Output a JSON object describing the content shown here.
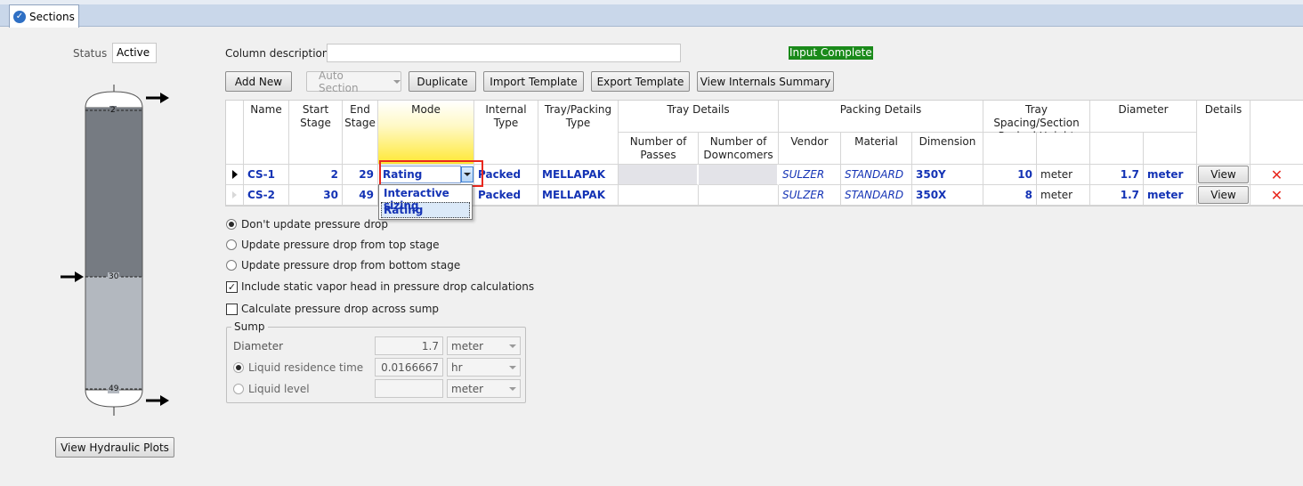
{
  "tab": {
    "label": "Sections"
  },
  "status": {
    "label": "Status",
    "value": "Active"
  },
  "column_description": {
    "label": "Column description",
    "value": ""
  },
  "input_status": "Input Complete",
  "toolbar": {
    "add_new": "Add New",
    "auto_section": "Auto Section",
    "duplicate": "Duplicate",
    "import_template": "Import Template",
    "export_template": "Export Template",
    "view_internals_summary": "View Internals Summary"
  },
  "column_graphic": {
    "top_stage": "2",
    "feed_stage": "30",
    "bottom_stage": "49"
  },
  "view_hydraulic_plots": "View Hydraulic Plots",
  "grid": {
    "headers": {
      "name": "Name",
      "start_stage": "Start Stage",
      "end_stage": "End Stage",
      "mode": "Mode",
      "internal_type": "Internal Type",
      "tray_packing_type": "Tray/Packing Type",
      "tray_details": "Tray Details",
      "number_of_passes": "Number of Passes",
      "number_of_downcomers": "Number of Downcomers",
      "packing_details": "Packing Details",
      "vendor": "Vendor",
      "material": "Material",
      "dimension": "Dimension",
      "tray_spacing": "Tray Spacing/Section Packed Height",
      "diameter": "Diameter",
      "details": "Details"
    },
    "rows": [
      {
        "name": "CS-1",
        "start": "2",
        "end": "29",
        "mode": "Rating",
        "internal_type": "Packed",
        "tray_type": "MELLAPAK",
        "vendor": "SULZER",
        "material": "STANDARD",
        "dimension": "350Y",
        "height": "10",
        "height_unit": "meter",
        "diameter": "1.7",
        "diameter_unit": "meter",
        "details": "View"
      },
      {
        "name": "CS-2",
        "start": "30",
        "end": "49",
        "mode": "",
        "internal_type": "Packed",
        "tray_type": "MELLAPAK",
        "vendor": "SULZER",
        "material": "STANDARD",
        "dimension": "350X",
        "height": "8",
        "height_unit": "meter",
        "diameter": "1.7",
        "diameter_unit": "meter",
        "details": "View"
      }
    ],
    "mode_options": [
      "Interactive sizing",
      "Rating"
    ]
  },
  "pressure_options": {
    "dont_update": "Don't update pressure drop",
    "from_top": "Update pressure drop from top stage",
    "from_bottom": "Update pressure drop from bottom stage",
    "static_head": "Include static vapor head in pressure drop calculations",
    "across_sump": "Calculate pressure drop across sump"
  },
  "sump": {
    "title": "Sump",
    "diameter_label": "Diameter",
    "diameter_value": "1.7",
    "diameter_unit": "meter",
    "residence_label": "Liquid residence time",
    "residence_value": "0.0166667",
    "residence_unit": "hr",
    "level_label": "Liquid level",
    "level_value": "",
    "level_unit": "meter"
  },
  "colors": {
    "accent": "#1433b5",
    "status_green": "#1a8a1a",
    "highlight_red": "#e8281e"
  }
}
